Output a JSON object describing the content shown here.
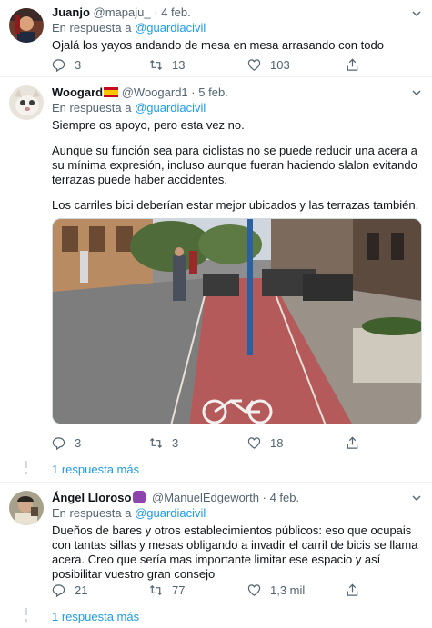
{
  "tweets": [
    {
      "name": "Juanjo",
      "handle": "@mapaju_",
      "sep": "·",
      "date": "4 feb.",
      "reply_prefix": "En respuesta a",
      "reply_to": "@guardiacivil",
      "text": "Ojalá los yayos andando de mesa en mesa arrasando con todo",
      "replies": "3",
      "retweets": "13",
      "likes": "103"
    },
    {
      "name": "Woogard",
      "name_emoji": "flag-spain-icon",
      "handle": "@Woogard1",
      "sep": "·",
      "date": "5 feb.",
      "reply_prefix": "En respuesta a",
      "reply_to": "@guardiacivil",
      "text_p1": "Siempre os apoyo, pero esta vez no.",
      "text_p2": "Aunque su función sea para ciclistas no se puede reducir una acera a su mínima expresión, incluso aunque fueran haciendo slalon evitando terrazas puede haber accidentes.",
      "text_p3": "Los carriles bici deberían estar mejor ubicados y las terrazas también.",
      "replies": "3",
      "retweets": "3",
      "likes": "18",
      "more_replies": "1 respuesta más"
    },
    {
      "name": "Ángel Lloroso",
      "name_emoji": "purple-badge-icon",
      "handle": "@ManuelEdgeworth",
      "sep": "·",
      "date": "4 feb.",
      "reply_prefix": "En respuesta a",
      "reply_to": "@guardiacivil",
      "text": "Dueños de bares y otros establecimientos públicos: eso que ocupais con tantas sillas y mesas obligando a invadir el carril de bicis se llama acera. Creo que sería mas importante limitar ese espacio y así posibilitar vuestro gran consejo",
      "replies": "21",
      "retweets": "77",
      "likes": "1,3 mil",
      "more_replies": "1 respuesta más"
    }
  ],
  "colors": {
    "accent": "#1d9bf0",
    "secondary_text": "#536471",
    "bike_lane": "#b55a5a"
  }
}
